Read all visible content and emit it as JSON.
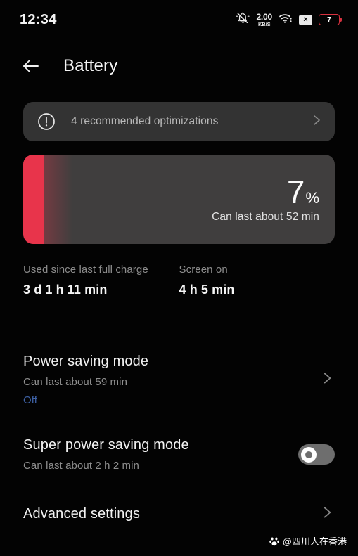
{
  "statusbar": {
    "time": "12:34",
    "mute_icon": "bell-muted-icon",
    "netspeed_value": "2.00",
    "netspeed_unit": "KB/S",
    "wifi_icon": "wifi-icon",
    "sim_badge": "×",
    "battery_level": "7",
    "battery_color": "#d8313f"
  },
  "appbar": {
    "back_icon": "back-arrow-icon",
    "title": "Battery"
  },
  "banner": {
    "icon": "alert-circle-icon",
    "text": "4 recommended optimizations",
    "chevron_icon": "chevron-right-icon"
  },
  "battery_card": {
    "percent_number": "7",
    "percent_symbol": "%",
    "percent_value": 7,
    "subtitle": "Can last about 52 min",
    "fill_color": "#e8344b",
    "track_color": "#403e3e"
  },
  "stats": [
    {
      "label": "Used since last full charge",
      "value": "3 d 1 h 11 min"
    },
    {
      "label": "Screen on",
      "value": "4 h 5 min"
    }
  ],
  "rows": {
    "power_saving": {
      "title": "Power saving mode",
      "subtitle": "Can last about 59 min",
      "state": "Off",
      "state_color": "#3f63a8",
      "chevron_icon": "chevron-right-icon"
    },
    "super_power_saving": {
      "title": "Super power saving mode",
      "subtitle": "Can last about 2 h 2 min",
      "toggle_on": false
    },
    "advanced": {
      "title": "Advanced settings",
      "chevron_icon": "chevron-right-icon"
    }
  },
  "watermark": {
    "icon": "paw-logo-icon",
    "text": "@四川人在香港"
  }
}
